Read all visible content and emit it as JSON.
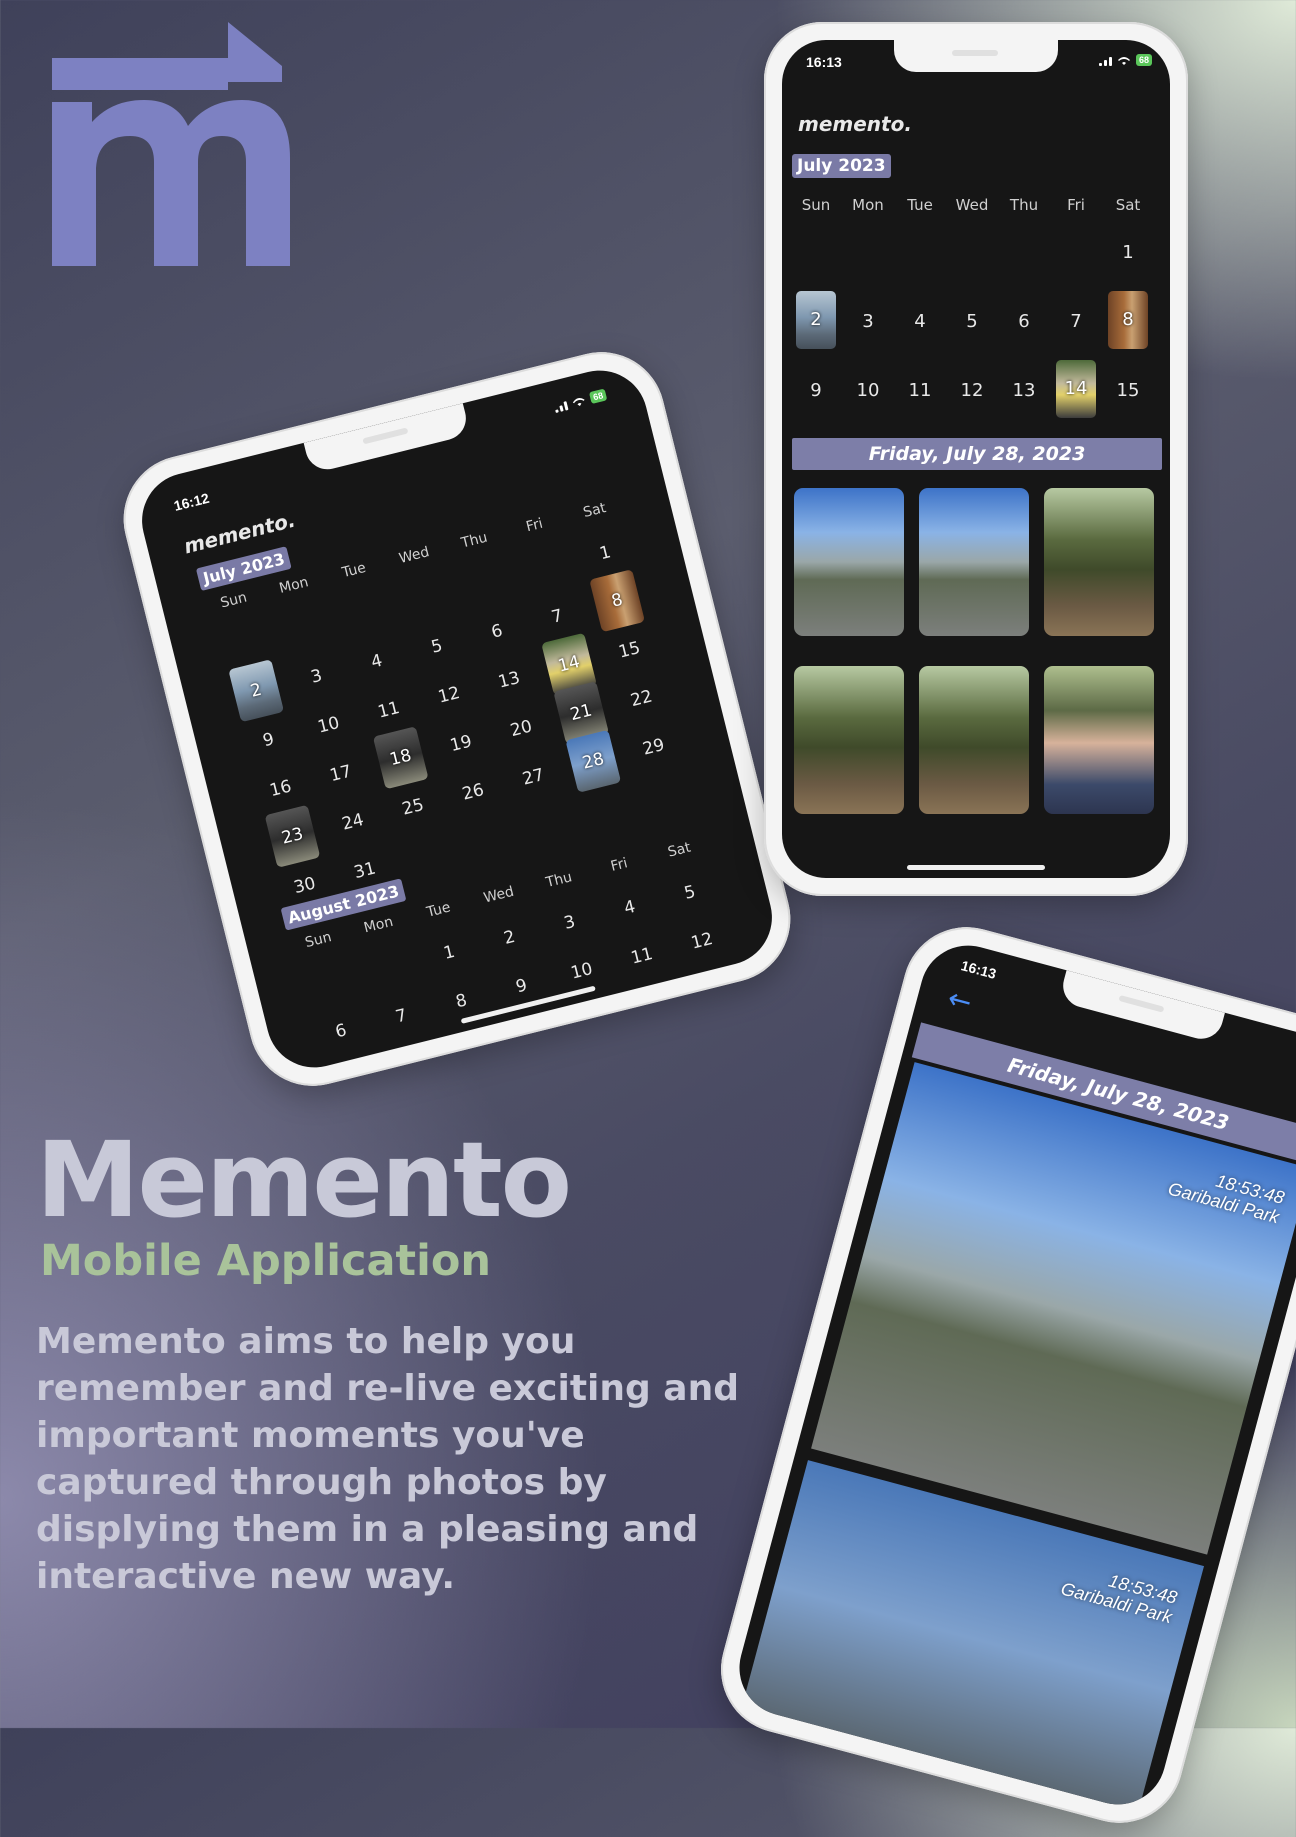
{
  "poster": {
    "title": "Memento",
    "subtitle": "Mobile Application",
    "description": "Memento aims to help you remember and re-live exciting and important moments you've captured through photos by displying them in a pleasing and interactive new way.",
    "colors": {
      "logo": "#7d81c2",
      "title": "#c8c9d8",
      "subtitle": "#a9c39a",
      "accent": "#7d7ea8"
    },
    "logo_icon": "memento-m-arrow-logo"
  },
  "phone_tilted": {
    "status_time": "16:12",
    "battery": "68",
    "app_name": "memento.",
    "month1": {
      "label": "July 2023",
      "weekdays": [
        "Sun",
        "Mon",
        "Tue",
        "Wed",
        "Thu",
        "Fri",
        "Sat"
      ],
      "rows": [
        [
          "",
          "",
          "",
          "",
          "",
          "",
          "1"
        ],
        [
          "2",
          "3",
          "4",
          "5",
          "6",
          "7",
          "8"
        ],
        [
          "9",
          "10",
          "11",
          "12",
          "13",
          "14",
          "15"
        ],
        [
          "16",
          "17",
          "18",
          "19",
          "20",
          "21",
          "22"
        ],
        [
          "23",
          "24",
          "25",
          "26",
          "27",
          "28",
          "29"
        ],
        [
          "30",
          "31",
          "",
          "",
          "",
          "",
          ""
        ]
      ],
      "photo_days": [
        "2",
        "8",
        "14",
        "18",
        "21",
        "23",
        "28"
      ]
    },
    "month2": {
      "label": "August 2023",
      "weekdays": [
        "Sun",
        "Mon",
        "Tue",
        "Wed",
        "Thu",
        "Fri",
        "Sat"
      ],
      "rows": [
        [
          "",
          "",
          "1",
          "2",
          "3",
          "4",
          "5"
        ],
        [
          "6",
          "7",
          "8",
          "9",
          "10",
          "11",
          "12"
        ]
      ]
    }
  },
  "phone_top": {
    "status_time": "16:13",
    "battery": "68",
    "app_name": "memento.",
    "month": {
      "label": "July 2023",
      "weekdays": [
        "Sun",
        "Mon",
        "Tue",
        "Wed",
        "Thu",
        "Fri",
        "Sat"
      ],
      "rows": [
        [
          "",
          "",
          "",
          "",
          "",
          "",
          "1"
        ],
        [
          "2",
          "3",
          "4",
          "5",
          "6",
          "7",
          "8"
        ],
        [
          "9",
          "10",
          "11",
          "12",
          "13",
          "14",
          "15"
        ]
      ],
      "photo_days": [
        "2",
        "8",
        "14"
      ]
    },
    "selected_date": "Friday, July 28, 2023",
    "thumbnails": [
      "mountain-hikers",
      "mountain-trail",
      "forest-path",
      "forest-trail",
      "forest-trees",
      "group-selfie"
    ]
  },
  "phone_bottom": {
    "status_time": "16:13",
    "selected_date": "Friday, July 28, 2023",
    "photos": [
      {
        "time": "18:53:48",
        "place": "Garibaldi Park"
      },
      {
        "time": "18:53:48",
        "place": "Garibaldi Park"
      }
    ]
  }
}
